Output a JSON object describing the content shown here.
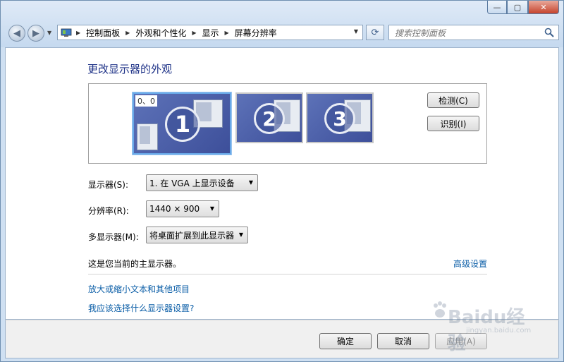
{
  "titlebar": {
    "minimize": "—",
    "maximize": "▢",
    "close": "✕"
  },
  "nav": {
    "back": "◀",
    "forward": "▶",
    "refresh": "⟳"
  },
  "breadcrumb": [
    "控制面板",
    "外观和个性化",
    "显示",
    "屏幕分辨率"
  ],
  "search": {
    "placeholder": "搜索控制面板"
  },
  "page": {
    "title": "更改显示器的外观"
  },
  "monitors": {
    "coord_label": "0、0",
    "items": [
      "1",
      "2",
      "3"
    ]
  },
  "panel_buttons": {
    "detect": "检测(C)",
    "identify": "识别(I)"
  },
  "fields": {
    "display_label": "显示器(S):",
    "display_value": "1. 在 VGA 上显示设备",
    "resolution_label": "分辨率(R):",
    "resolution_value": "1440 × 900",
    "multi_label": "多显示器(M):",
    "multi_value": "将桌面扩展到此显示器"
  },
  "info": {
    "primary_text": "这是您当前的主显示器。",
    "advanced_link": "高级设置"
  },
  "links": {
    "text_size": "放大或缩小文本和其他项目",
    "which_settings": "我应该选择什么显示器设置?"
  },
  "footer": {
    "ok": "确定",
    "cancel": "取消",
    "apply": "应用(A)"
  },
  "watermark": {
    "text": "Baidu经验",
    "sub": "jingyan.baidu.com"
  },
  "colors": {
    "link": "#0b5ea7",
    "title": "#1e3287",
    "monitor": "#4a5ea8",
    "selected_border": "#69a9e8"
  },
  "icons": [
    "control-panel-icon",
    "refresh-icon",
    "search-icon",
    "back-icon",
    "forward-icon"
  ]
}
